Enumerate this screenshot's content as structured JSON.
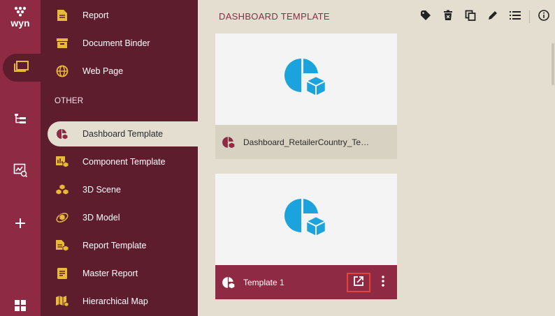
{
  "rail": {
    "logo": "wyn",
    "buttons": [
      {
        "icon": "folder-icon",
        "active": true
      },
      {
        "icon": "hierarchy-icon",
        "active": false
      },
      {
        "icon": "monitor-chart-icon",
        "active": false
      },
      {
        "icon": "plus-icon",
        "active": false
      },
      {
        "icon": "grid-icon",
        "active": false
      }
    ]
  },
  "nav": {
    "items_top": [
      {
        "label": "Report",
        "icon": "report-icon"
      },
      {
        "label": "Document Binder",
        "icon": "binder-icon"
      },
      {
        "label": "Web Page",
        "icon": "globe-icon"
      }
    ],
    "section_label": "OTHER",
    "items_other": [
      {
        "label": "Dashboard Template",
        "icon": "dashboard-template-icon",
        "active": true
      },
      {
        "label": "Component Template",
        "icon": "component-template-icon"
      },
      {
        "label": "3D Scene",
        "icon": "3d-scene-icon"
      },
      {
        "label": "3D Model",
        "icon": "3d-model-icon"
      },
      {
        "label": "Report Template",
        "icon": "report-template-icon"
      },
      {
        "label": "Master Report",
        "icon": "master-report-icon"
      },
      {
        "label": "Hierarchical Map",
        "icon": "hierarchical-map-icon"
      }
    ]
  },
  "main": {
    "title": "DASHBOARD TEMPLATE",
    "toolbar": [
      "tag-icon",
      "delete-icon",
      "copy-icon",
      "edit-icon",
      "list-icon",
      "info-icon"
    ],
    "cards": [
      {
        "name": "Dashboard_RetailerCountry_Tem..."
      },
      {
        "name": "Template 1"
      }
    ]
  },
  "colors": {
    "brand": "#8e2a44",
    "nav_bg": "#5e1d2d",
    "accent_icon": "#e9b93a",
    "thumb_icon": "#1aa3dc",
    "highlight": "#e8413a"
  }
}
